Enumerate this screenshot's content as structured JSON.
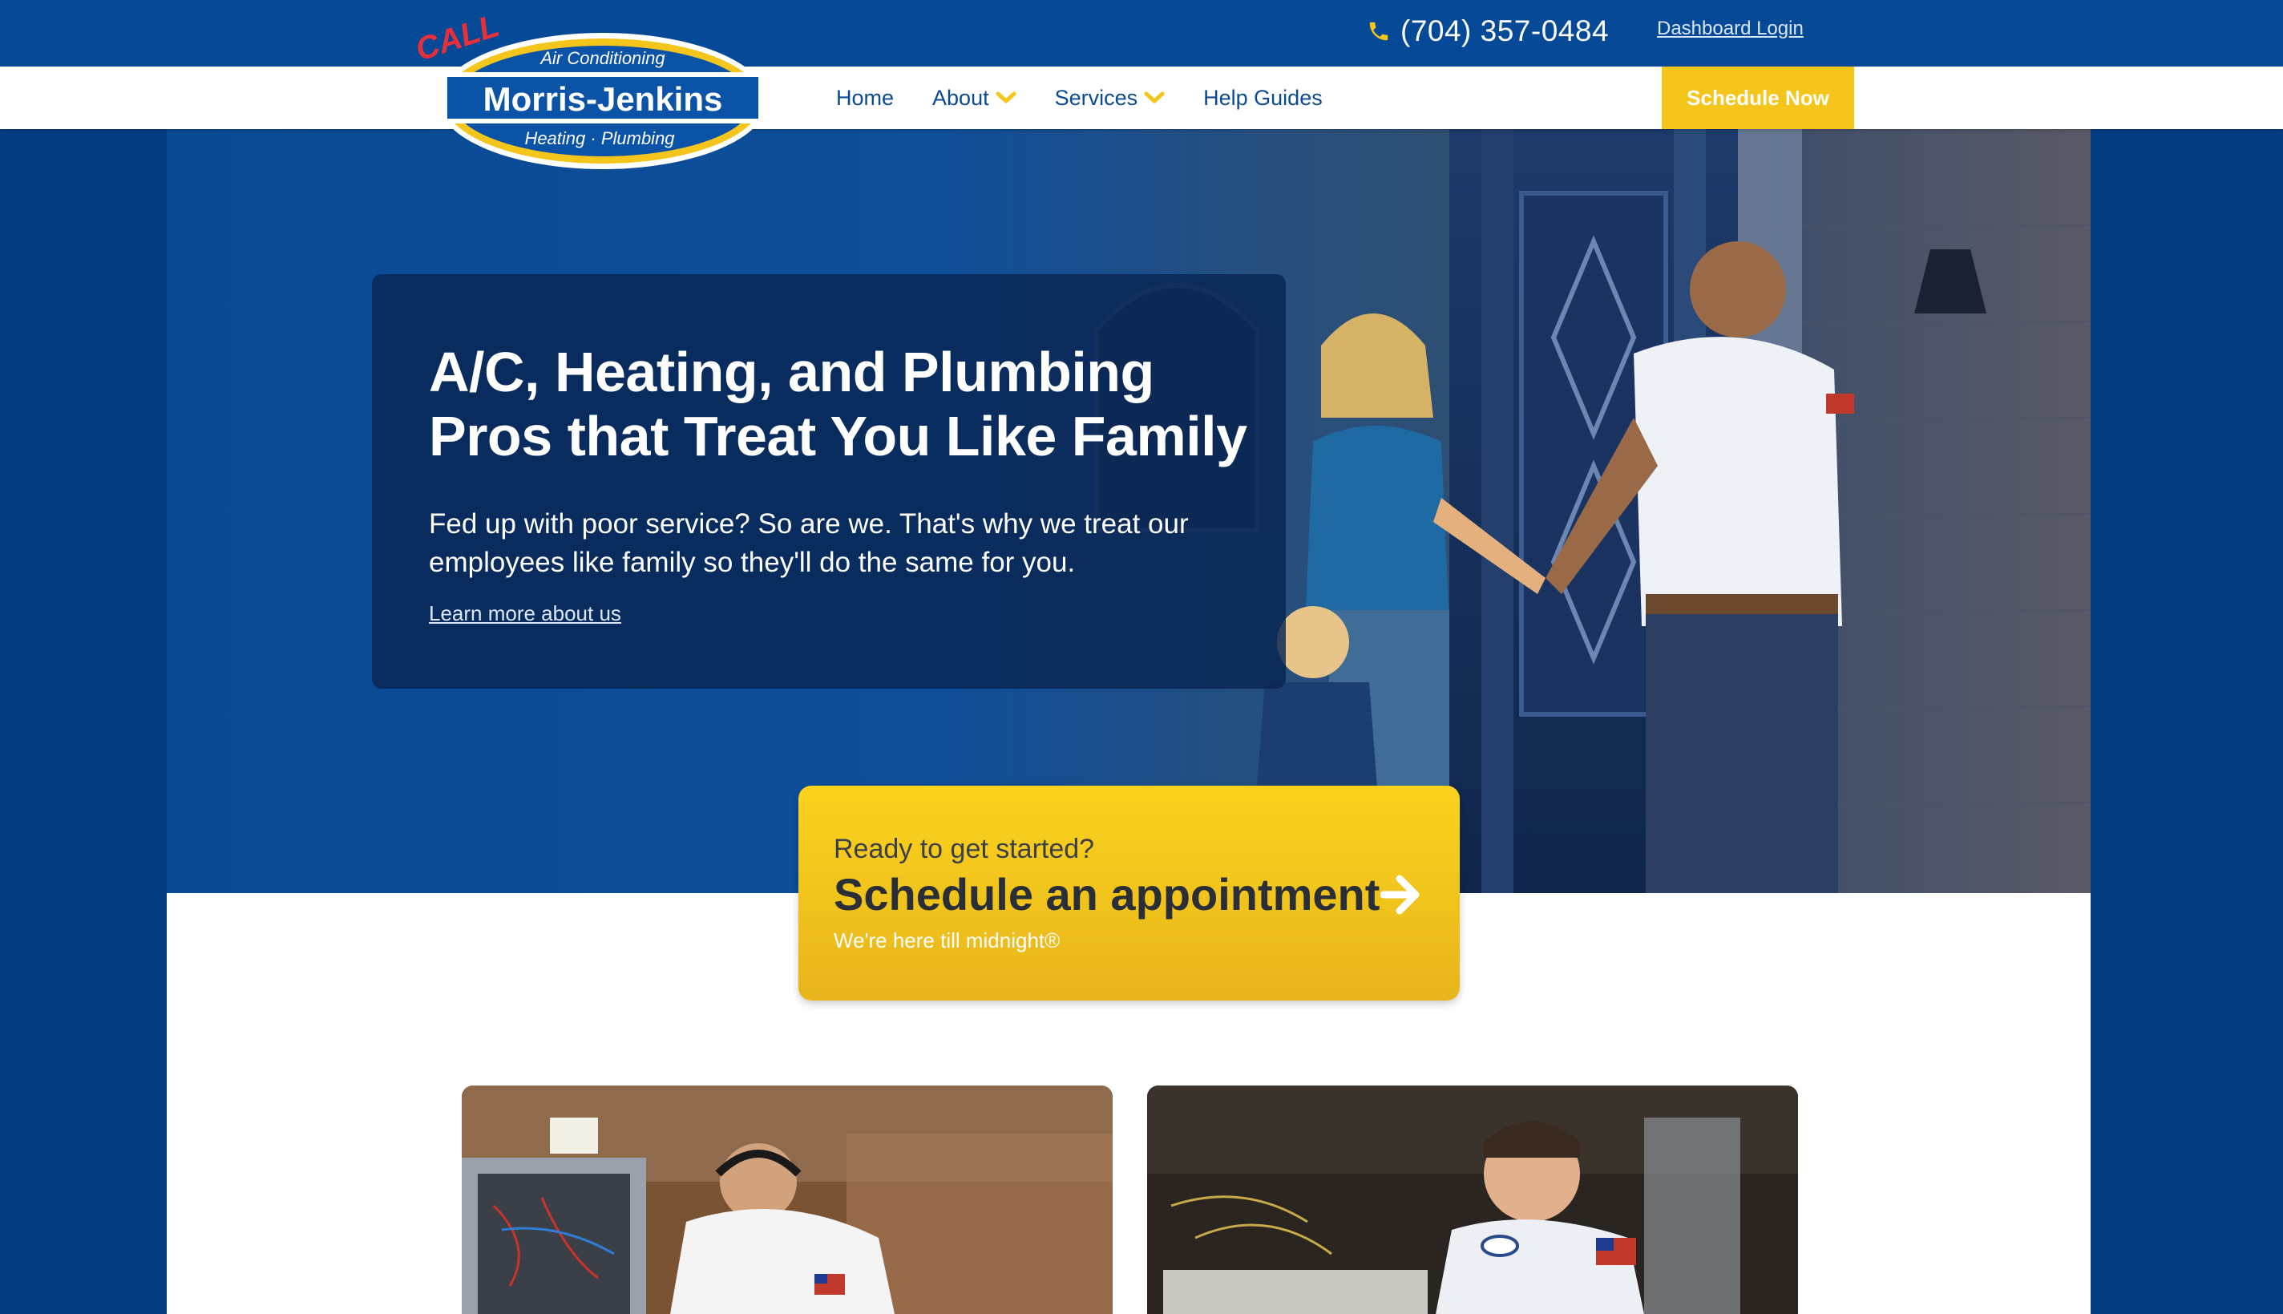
{
  "topbar": {
    "phone": "(704) 357-0484",
    "dashboard_login": "Dashboard Login"
  },
  "logo": {
    "call": "CALL",
    "top_text": "Air Conditioning",
    "brand": "Morris-Jenkins",
    "bottom_text": "Heating · Plumbing"
  },
  "nav": {
    "items": [
      {
        "label": "Home",
        "has_dropdown": false
      },
      {
        "label": "About",
        "has_dropdown": true
      },
      {
        "label": "Services",
        "has_dropdown": true
      },
      {
        "label": "Help Guides",
        "has_dropdown": false
      }
    ],
    "schedule_button": "Schedule Now"
  },
  "hero": {
    "title_line1": "A/C, Heating, and Plumbing",
    "title_line2": "Pros that Treat You Like Family",
    "subtitle_line1": "Fed up with poor service? So are we. That's why we treat our",
    "subtitle_line2": "employees like family so they'll do the same for you.",
    "link": "Learn more about us"
  },
  "cta": {
    "pre": "Ready to get started?",
    "main": "Schedule an appointment",
    "note": "We're here till midnight®"
  },
  "colors": {
    "page_bg": "#053c82",
    "topbar_bg": "#064a97",
    "nav_text": "#0a4a95",
    "accent_yellow": "#f4c51a",
    "hero_card": "#082452"
  },
  "icons": {
    "phone": "phone-icon",
    "dropdown": "chevron-down-icon",
    "cta_arrow": "arrow-right-icon"
  }
}
